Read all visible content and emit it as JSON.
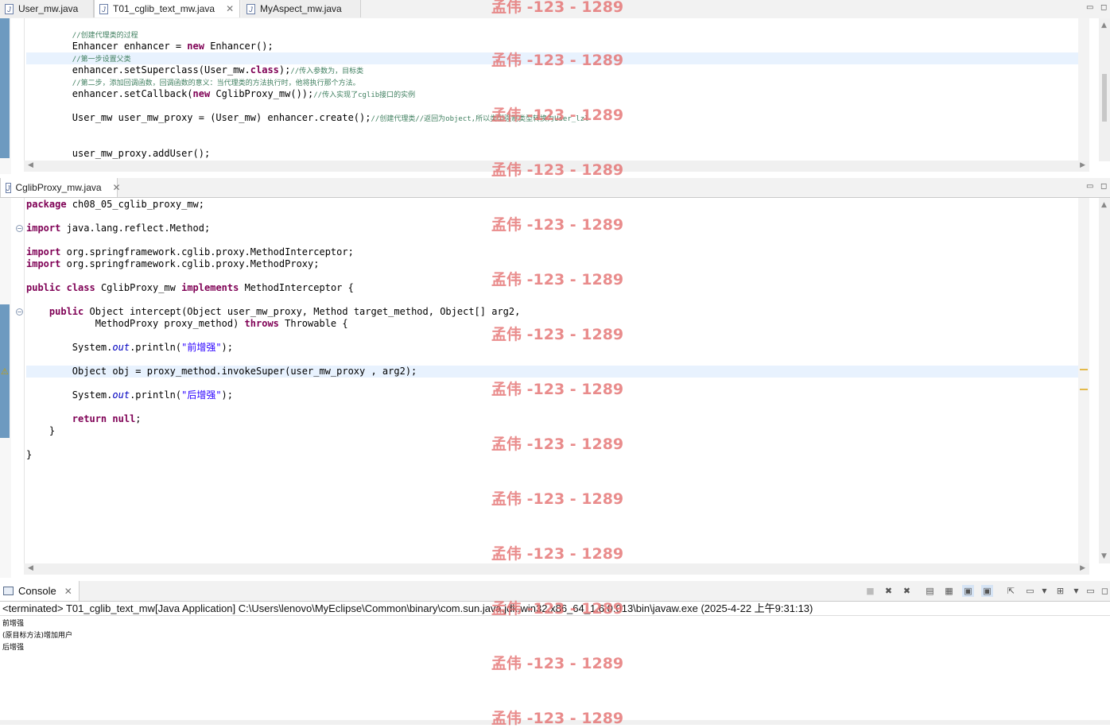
{
  "top_editor": {
    "tabs": [
      {
        "label": "User_mw.java",
        "active": false
      },
      {
        "label": "T01_cglib_text_mw.java",
        "active": true
      },
      {
        "label": "MyAspect_mw.java",
        "active": false
      }
    ],
    "code_lines": [
      {
        "tokens": [
          {
            "t": "//创建代理类的过程",
            "c": "cm"
          }
        ]
      },
      {
        "tokens": [
          {
            "t": "Enhancer enhancer = "
          },
          {
            "t": "new",
            "c": "kw"
          },
          {
            "t": " Enhancer();"
          }
        ]
      },
      {
        "tokens": [
          {
            "t": "//第一步设置父类",
            "c": "cm"
          }
        ]
      },
      {
        "tokens": [
          {
            "t": "enhancer.setSuperclass(User_mw."
          },
          {
            "t": "class",
            "c": "kw"
          },
          {
            "t": ");"
          },
          {
            "t": "//传入参数为，目标类",
            "c": "cm"
          }
        ]
      },
      {
        "tokens": [
          {
            "t": "//第二步，添加回调函数，回调函数的意义：当代理类的方法执行时，他将执行那个方法。",
            "c": "cm"
          }
        ]
      },
      {
        "tokens": [
          {
            "t": "enhancer.setCallback("
          },
          {
            "t": "new",
            "c": "kw"
          },
          {
            "t": " CglibProxy_mw());"
          },
          {
            "t": "//传入实现了cglib接口的实例",
            "c": "cm"
          }
        ]
      },
      {
        "tokens": []
      },
      {
        "tokens": [
          {
            "t": "User_mw user_mw_proxy = (User_mw) enhancer.create();"
          },
          {
            "t": "//创建代理类//返回为object,所以类型强制类型转换为User_lzl",
            "c": "cm"
          }
        ]
      },
      {
        "tokens": []
      },
      {
        "tokens": []
      },
      {
        "tokens": [
          {
            "t": "user_mw_proxy.addUser();"
          }
        ]
      }
    ]
  },
  "bottom_editor": {
    "tab_label": "CglibProxy_mw.java",
    "code_lines": [
      {
        "tokens": [
          {
            "t": "package",
            "c": "kw"
          },
          {
            "t": " ch08_05_cglib_proxy_mw;"
          }
        ]
      },
      {
        "tokens": []
      },
      {
        "tokens": [
          {
            "t": "import",
            "c": "kw"
          },
          {
            "t": " java.lang.reflect.Method;"
          }
        ]
      },
      {
        "tokens": []
      },
      {
        "tokens": [
          {
            "t": "import",
            "c": "kw"
          },
          {
            "t": " org.springframework.cglib.proxy.MethodInterceptor;"
          }
        ]
      },
      {
        "tokens": [
          {
            "t": "import",
            "c": "kw"
          },
          {
            "t": " org.springframework.cglib.proxy.MethodProxy;"
          }
        ]
      },
      {
        "tokens": []
      },
      {
        "tokens": [
          {
            "t": "public",
            "c": "kw"
          },
          {
            "t": " "
          },
          {
            "t": "class",
            "c": "kw"
          },
          {
            "t": " CglibProxy_mw "
          },
          {
            "t": "implements",
            "c": "kw"
          },
          {
            "t": " MethodInterceptor {"
          }
        ]
      },
      {
        "tokens": []
      },
      {
        "tokens": [
          {
            "t": "    "
          },
          {
            "t": "public",
            "c": "kw"
          },
          {
            "t": " Object intercept(Object user_mw_proxy, Method target_method, Object[] arg2,"
          }
        ]
      },
      {
        "tokens": [
          {
            "t": "            MethodProxy proxy_method) "
          },
          {
            "t": "throws",
            "c": "kw"
          },
          {
            "t": " Throwable {"
          }
        ]
      },
      {
        "tokens": []
      },
      {
        "tokens": [
          {
            "t": "        System."
          },
          {
            "t": "out",
            "c": "fld"
          },
          {
            "t": ".println("
          },
          {
            "t": "\"前增强\"",
            "c": "st"
          },
          {
            "t": ");"
          }
        ]
      },
      {
        "tokens": []
      },
      {
        "tokens": [
          {
            "t": "        Object obj = proxy_method.invokeSuper(user_mw_proxy , arg2);"
          }
        ]
      },
      {
        "tokens": []
      },
      {
        "tokens": [
          {
            "t": "        System."
          },
          {
            "t": "out",
            "c": "fld"
          },
          {
            "t": ".println("
          },
          {
            "t": "\"后增强\"",
            "c": "st"
          },
          {
            "t": ");"
          }
        ]
      },
      {
        "tokens": []
      },
      {
        "tokens": [
          {
            "t": "        "
          },
          {
            "t": "return",
            "c": "kw"
          },
          {
            "t": " "
          },
          {
            "t": "null",
            "c": "kw"
          },
          {
            "t": ";"
          }
        ]
      },
      {
        "tokens": [
          {
            "t": "    }"
          }
        ]
      },
      {
        "tokens": []
      },
      {
        "tokens": [
          {
            "t": "}"
          }
        ]
      }
    ]
  },
  "console": {
    "tab_label": "Console",
    "status": "<terminated> T01_cglib_text_mw[Java Application] C:\\Users\\lenovo\\MyEclipse\\Common\\binary\\com.sun.java.jdk.win32.x86_64_1.6.0.013\\bin\\javaw.exe (2025-4-22 上午9:31:13)",
    "output": [
      "前增强",
      "(原目标方法)增加用户",
      "后增强"
    ]
  },
  "watermark": "孟伟 -123 - 1289",
  "colors": {
    "keyword": "#7f0055",
    "comment": "#3f7f5f",
    "string": "#2a00ff",
    "field": "#0000c0",
    "current_line": "#e8f2fe",
    "watermark": "#e57373"
  },
  "icons": [
    "java-file-icon",
    "close-icon",
    "console-icon",
    "fold-icon",
    "warning-icon"
  ]
}
